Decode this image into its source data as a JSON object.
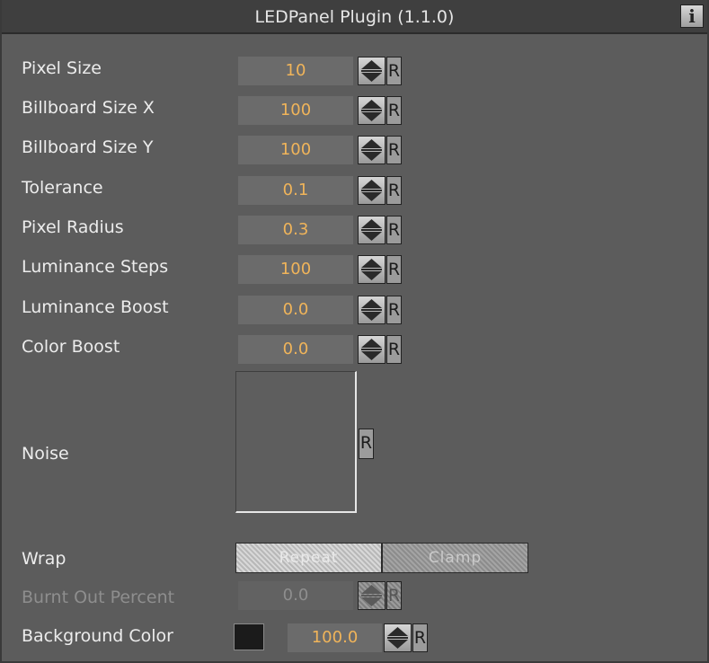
{
  "window": {
    "title": "LEDPanel Plugin (1.1.0)",
    "info_icon": "info-icon",
    "info_glyph": "i"
  },
  "reset_label": "R",
  "params": {
    "pixel_size": {
      "label": "Pixel Size",
      "value": "10"
    },
    "billboard_size_x": {
      "label": "Billboard Size X",
      "value": "100"
    },
    "billboard_size_y": {
      "label": "Billboard Size Y",
      "value": "100"
    },
    "tolerance": {
      "label": "Tolerance",
      "value": "0.1"
    },
    "pixel_radius": {
      "label": "Pixel Radius",
      "value": "0.3"
    },
    "luminance_steps": {
      "label": "Luminance Steps",
      "value": "100"
    },
    "luminance_boost": {
      "label": "Luminance Boost",
      "value": "0.0"
    },
    "color_boost": {
      "label": "Color Boost",
      "value": "0.0"
    },
    "noise": {
      "label": "Noise"
    },
    "wrap": {
      "label": "Wrap",
      "options": [
        "Repeat",
        "Clamp"
      ],
      "selected": "Repeat"
    },
    "burnt_out_percent": {
      "label": "Burnt Out Percent",
      "value": "0.0",
      "disabled": true
    },
    "background_color": {
      "label": "Background Color",
      "value": "100.0",
      "swatch_color": "#1b1b1b"
    }
  },
  "colors": {
    "panel_bg": "#5c5c5c",
    "title_bg": "#3f3f3f",
    "value_text": "#f0b45a",
    "label_text": "#ececec"
  }
}
